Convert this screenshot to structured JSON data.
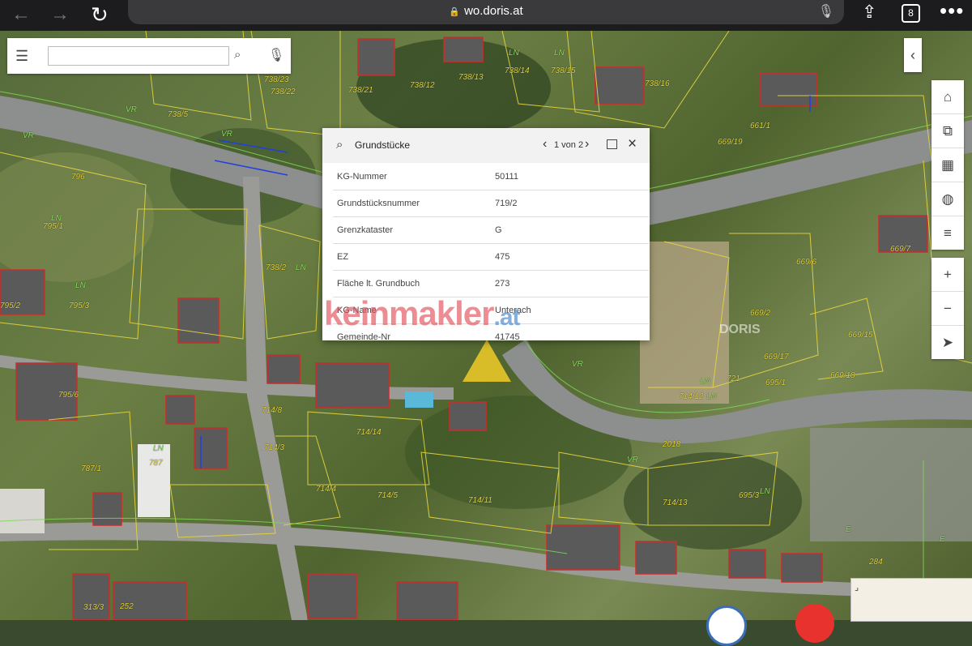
{
  "browser": {
    "url": "wo.doris.at",
    "tab_count": "8",
    "icons": {
      "back": "arrow-left-icon",
      "forward": "arrow-right-icon",
      "reload": "reload-icon",
      "lock": "lock-icon",
      "mic": "microphone-icon",
      "share": "share-icon",
      "more": "more-icon"
    }
  },
  "search": {
    "placeholder": "",
    "icons": {
      "menu": "hamburger-icon",
      "search": "search-icon",
      "mic": "microphone-icon"
    }
  },
  "toolbar": {
    "collapse_icon": "chevron-left-icon",
    "tools": [
      "tag-icon",
      "layers-icon",
      "basemap-icon",
      "globe-icon",
      "list-icon"
    ],
    "zoom": [
      "plus-icon",
      "minus-icon",
      "compass-icon"
    ]
  },
  "popup": {
    "title": "Grundstücke",
    "pager": "1 von 2",
    "rows": [
      {
        "key": "KG-Nummer",
        "value": "50111"
      },
      {
        "key": "Grundstücksnummer",
        "value": "719/2"
      },
      {
        "key": "Grenzkataster",
        "value": "G"
      },
      {
        "key": "EZ",
        "value": "475"
      },
      {
        "key": "Fläche lt. Grundbuch",
        "value": "273"
      },
      {
        "key": "KG-Name",
        "value": "Unterach"
      },
      {
        "key": "Gemeinde-Nr",
        "value": "41745"
      }
    ]
  },
  "watermark": {
    "part1": "keinmakler",
    "part2": ".at"
  },
  "map": {
    "doris_logo": "DORIS",
    "parcel_labels": [
      "738/23",
      "738/22",
      "738/5",
      "738/12",
      "738/13",
      "738/14",
      "738/15",
      "738/16",
      "738/21",
      "796",
      "795/1",
      "795/3",
      "795/2",
      "795/6",
      "738/2",
      "661/1",
      "669/19",
      "669/7",
      "669/6",
      "669/2",
      "669/15",
      "669/17",
      "669/18",
      "695/1",
      "721",
      "714/12",
      "714/13",
      "714/11",
      "714/8",
      "714/3",
      "714/4",
      "714/5",
      "714/14",
      "787",
      "2018",
      "695/3",
      "787/1",
      "252",
      "313/3",
      "284"
    ],
    "land_use_labels": [
      "VR",
      "VR",
      "VR",
      "LN",
      "LN",
      "LN",
      "LN",
      "LN",
      "LN",
      "LN",
      "VR",
      "VR",
      "LN",
      "LN",
      "E",
      "E"
    ]
  }
}
